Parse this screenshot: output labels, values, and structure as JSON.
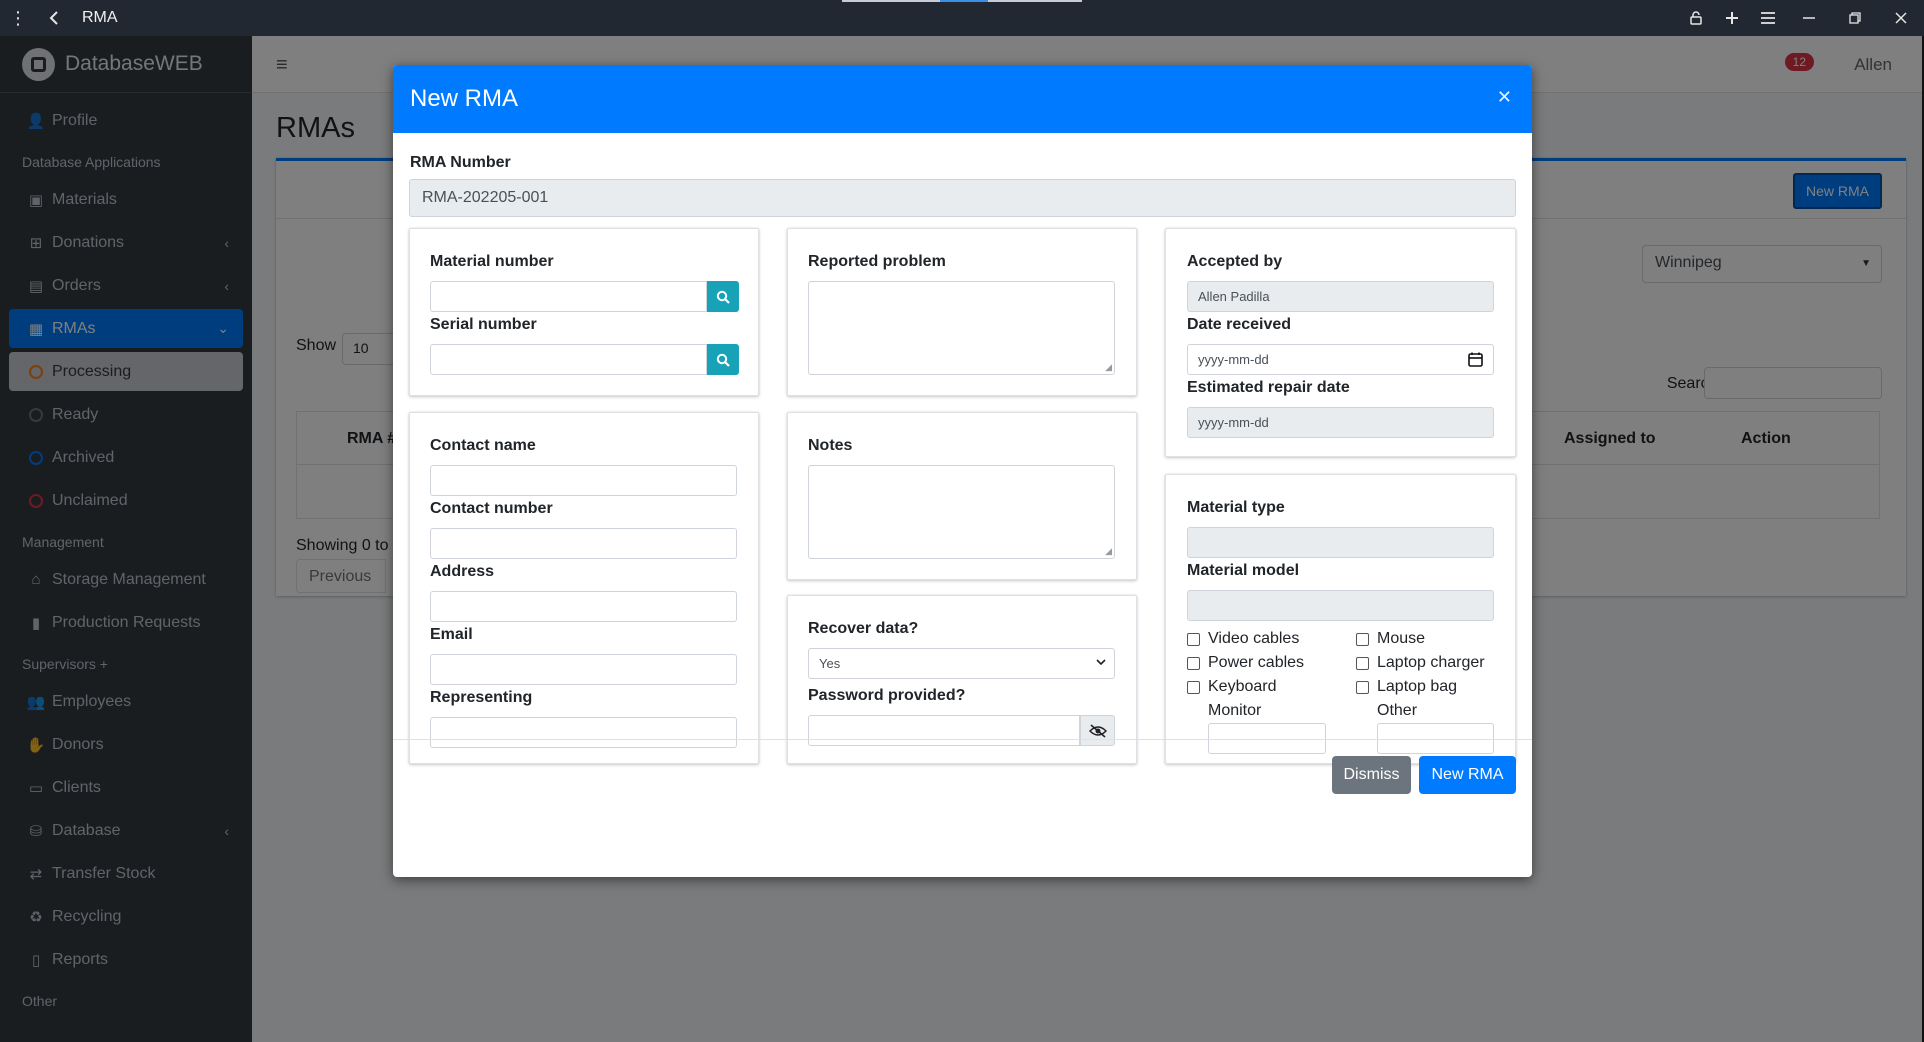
{
  "window": {
    "title": "RMA",
    "icons": {
      "menu": "kebab-menu-icon",
      "back": "back-arrow-icon",
      "lock": "unlock-icon",
      "add": "plus-icon",
      "hamburger": "hamburger-icon",
      "minimize": "minimize-icon",
      "restore": "restore-icon",
      "close": "close-icon"
    }
  },
  "sidebar": {
    "brand": "DatabaseWEB",
    "items": [
      {
        "type": "item",
        "label": "Profile",
        "icon": "user-icon"
      },
      {
        "type": "header",
        "label": "Database Applications"
      },
      {
        "type": "item",
        "label": "Materials",
        "icon": "box-icon"
      },
      {
        "type": "item",
        "label": "Donations",
        "icon": "donation-icon",
        "chevron": true
      },
      {
        "type": "item",
        "label": "Orders",
        "icon": "orders-icon",
        "chevron": true
      },
      {
        "type": "item",
        "label": "RMAs",
        "icon": "rma-icon",
        "chevron": true,
        "active": true
      },
      {
        "type": "sub",
        "label": "Processing",
        "color": "#fd7e14",
        "selected": true
      },
      {
        "type": "sub",
        "label": "Ready",
        "color": "#6c757d"
      },
      {
        "type": "sub",
        "label": "Archived",
        "color": "#007bff"
      },
      {
        "type": "sub",
        "label": "Unclaimed",
        "color": "#dc3545"
      },
      {
        "type": "header",
        "label": "Management"
      },
      {
        "type": "item",
        "label": "Storage Management",
        "icon": "warehouse-icon"
      },
      {
        "type": "item",
        "label": "Production Requests",
        "icon": "clipboard-icon"
      },
      {
        "type": "header",
        "label": "Supervisors +"
      },
      {
        "type": "item",
        "label": "Employees",
        "icon": "users-icon"
      },
      {
        "type": "item",
        "label": "Donors",
        "icon": "donors-icon"
      },
      {
        "type": "item",
        "label": "Clients",
        "icon": "id-card-icon"
      },
      {
        "type": "item",
        "label": "Database",
        "icon": "database-icon",
        "chevron": true
      },
      {
        "type": "item",
        "label": "Transfer Stock",
        "icon": "transfer-icon"
      },
      {
        "type": "item",
        "label": "Recycling",
        "icon": "recycle-icon"
      },
      {
        "type": "item",
        "label": "Reports",
        "icon": "book-icon"
      },
      {
        "type": "header",
        "label": "Other"
      }
    ]
  },
  "topnav": {
    "notifications": "12",
    "user": "Allen"
  },
  "page": {
    "title": "RMAs",
    "new_button": "New RMA",
    "city": "Winnipeg",
    "show_label": "Show",
    "show_value": "10",
    "search_label": "Search:",
    "columns": [
      "RMA #",
      "Assigned to",
      "Action"
    ],
    "showing": "Showing 0 to",
    "previous": "Previous"
  },
  "modal": {
    "title": "New RMA",
    "rma_number_label": "RMA Number",
    "rma_number_value": "RMA-202205-001",
    "material_number_label": "Material number",
    "serial_number_label": "Serial number",
    "reported_problem_label": "Reported problem",
    "accepted_by_label": "Accepted by",
    "accepted_by_value": "Allen Padilla",
    "date_received_label": "Date received",
    "date_received_placeholder": "yyyy-mm-dd",
    "estimated_repair_label": "Estimated repair date",
    "estimated_repair_placeholder": "yyyy-mm-dd",
    "contact_name_label": "Contact name",
    "contact_number_label": "Contact number",
    "address_label": "Address",
    "email_label": "Email",
    "representing_label": "Representing",
    "notes_label": "Notes",
    "recover_data_label": "Recover data?",
    "recover_data_value": "Yes",
    "password_label": "Password provided?",
    "material_type_label": "Material type",
    "material_model_label": "Material model",
    "accessories_left": [
      "Video cables",
      "Power cables",
      "Keyboard"
    ],
    "accessories_right": [
      "Mouse",
      "Laptop charger",
      "Laptop bag"
    ],
    "monitor_label": "Monitor",
    "other_label": "Other",
    "dismiss": "Dismiss",
    "submit": "New RMA"
  }
}
